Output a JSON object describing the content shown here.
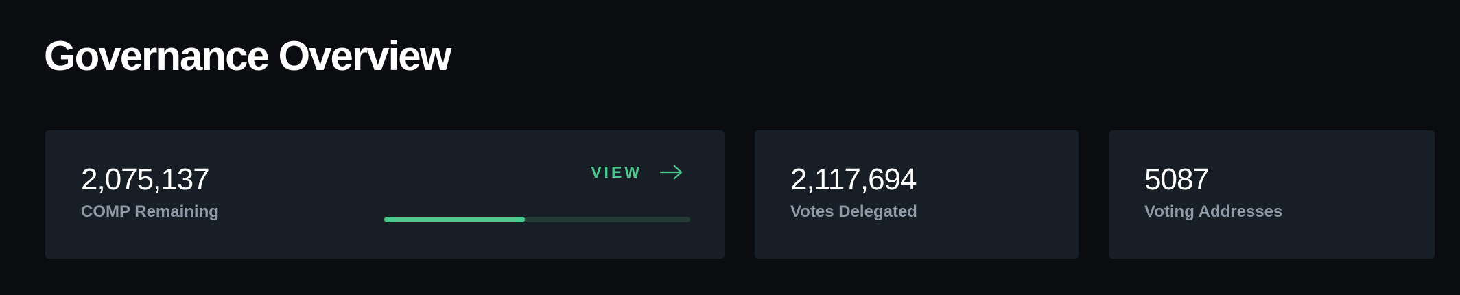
{
  "page": {
    "title": "Governance Overview"
  },
  "cards": {
    "comp_remaining": {
      "value": "2,075,137",
      "label": "COMP Remaining",
      "view_label": "VIEW",
      "progress_percent": 46
    },
    "votes_delegated": {
      "value": "2,117,694",
      "label": "Votes Delegated"
    },
    "voting_addresses": {
      "value": "5087",
      "label": "Voting Addresses"
    }
  },
  "colors": {
    "background": "#0a0c10",
    "card": "#171e25",
    "accent": "#4dc990",
    "track": "#233a35",
    "label": "#8e9aa6"
  },
  "icons": {
    "view_arrow": "arrow-right-icon"
  }
}
